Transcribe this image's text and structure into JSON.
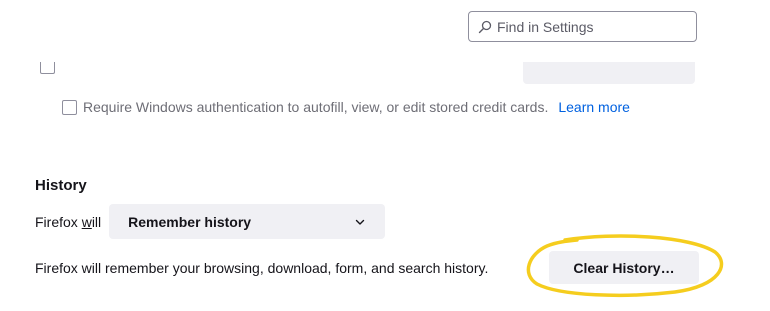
{
  "search": {
    "placeholder": "Find in Settings"
  },
  "autofill": {
    "require_auth_label": "Require Windows authentication to autofill, view, or edit stored credit cards.",
    "learn_more_label": "Learn more"
  },
  "history": {
    "title": "History",
    "firefox_will_prefix": "Firefox ",
    "firefox_will_accel": "w",
    "firefox_will_suffix": "ill",
    "mode_value": "Remember history",
    "description": "Firefox will remember your browsing, download, form, and search history.",
    "clear_button_label": "Clear History…"
  },
  "colors": {
    "link": "#0061e0",
    "button_bg": "#f0f0f4",
    "highlight_ring": "#f5cd1e",
    "text": "#15141a",
    "muted_text": "#6e6e76"
  },
  "icons": {
    "search": "search-icon",
    "dropdown": "chevron-down-icon"
  }
}
